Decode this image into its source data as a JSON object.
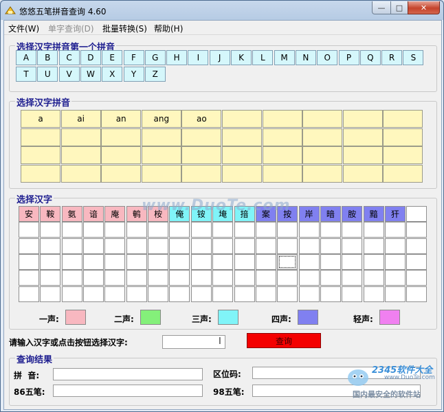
{
  "window": {
    "title": "悠悠五笔拼音查询 4.60"
  },
  "menu": [
    {
      "label": "文件(W)",
      "enabled": true
    },
    {
      "label": "单字查询(D)",
      "enabled": false
    },
    {
      "label": "批量转换(S)",
      "enabled": true
    },
    {
      "label": "帮助(H)",
      "enabled": true
    }
  ],
  "letters_group": {
    "legend": "选择汉字拼音第一个拼音",
    "letters": [
      "A",
      "B",
      "C",
      "D",
      "E",
      "F",
      "G",
      "H",
      "I",
      "J",
      "K",
      "L",
      "M",
      "N",
      "O",
      "P",
      "Q",
      "R",
      "S",
      "T",
      "U",
      "V",
      "W",
      "X",
      "Y",
      "Z"
    ]
  },
  "pinyin_group": {
    "legend": "选择汉字拼音",
    "syllables": [
      "a",
      "ai",
      "an",
      "ang",
      "ao"
    ]
  },
  "hanzi_group": {
    "legend": "选择汉字",
    "chars": [
      {
        "ch": "安",
        "tone": 1
      },
      {
        "ch": "鞍",
        "tone": 1
      },
      {
        "ch": "氨",
        "tone": 1
      },
      {
        "ch": "谙",
        "tone": 1
      },
      {
        "ch": "庵",
        "tone": 1
      },
      {
        "ch": "鹌",
        "tone": 1
      },
      {
        "ch": "桉",
        "tone": 1
      },
      {
        "ch": "俺",
        "tone": 3
      },
      {
        "ch": "铵",
        "tone": 3
      },
      {
        "ch": "埯",
        "tone": 3
      },
      {
        "ch": "揞",
        "tone": 3
      },
      {
        "ch": "案",
        "tone": 4
      },
      {
        "ch": "按",
        "tone": 4
      },
      {
        "ch": "岸",
        "tone": 4
      },
      {
        "ch": "暗",
        "tone": 4
      },
      {
        "ch": "胺",
        "tone": 4
      },
      {
        "ch": "黯",
        "tone": 4
      },
      {
        "ch": "犴",
        "tone": 4
      }
    ],
    "tone_legend": [
      {
        "label": "一声:",
        "color": "#f8b8c0"
      },
      {
        "label": "二声:",
        "color": "#84f07a"
      },
      {
        "label": "三声:",
        "color": "#80f4f8"
      },
      {
        "label": "四声:",
        "color": "#8080f0"
      },
      {
        "label": "轻声:",
        "color": "#f080f0"
      }
    ]
  },
  "search": {
    "prompt": "请输入汉字或点击按钮选择汉字:",
    "input_value": "",
    "button": "查询",
    "button_color": "#f40000"
  },
  "results": {
    "legend": "查询结果",
    "pinyin_label": "拼  音:",
    "quwei_label": "区位码:",
    "wubi86_label": "86五笔:",
    "wubi98_label": "98五笔:"
  },
  "watermarks": {
    "duote": "www.DuoTe.com",
    "brand": "2345软件大全",
    "brand_url": "www.DuoTe.com",
    "tagline": "国内最安全的软件站"
  }
}
